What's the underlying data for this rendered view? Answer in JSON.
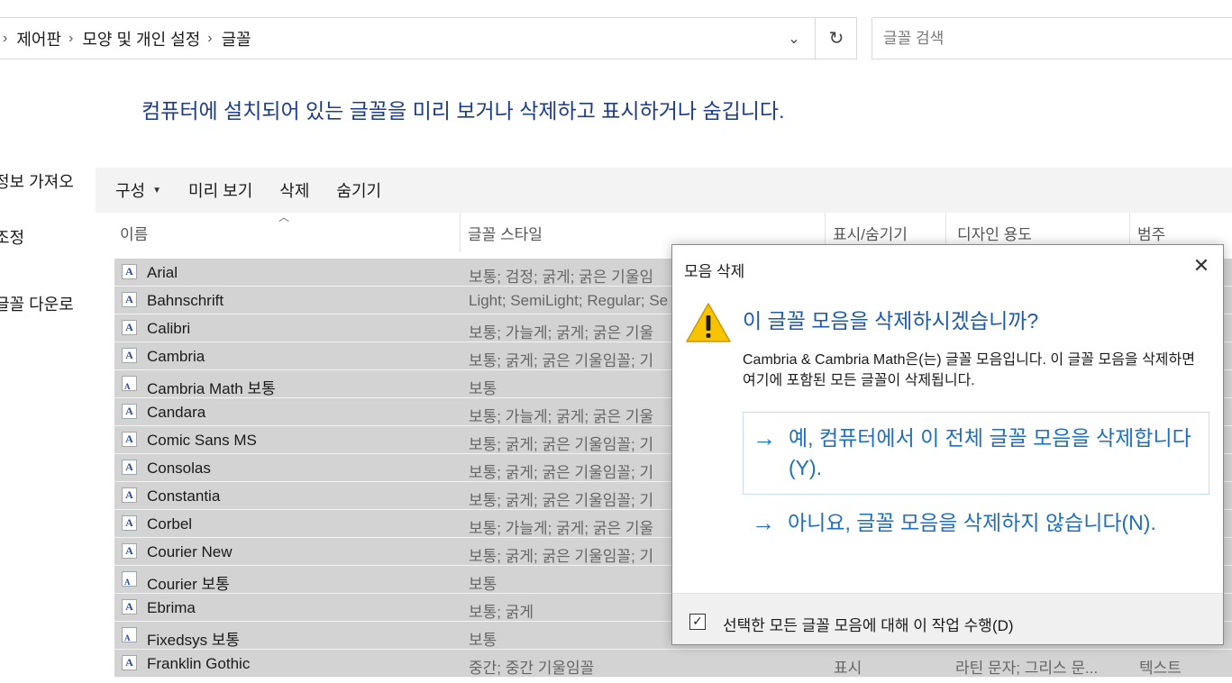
{
  "address_bar": {
    "crumbs": [
      "제어판",
      "모양 및 개인 설정",
      "글꼴"
    ],
    "search_placeholder": "글꼴 검색"
  },
  "headline": "컴퓨터에 설치되어 있는 글꼴을 미리 보거나 삭제하고 표시하거나 숨깁니다.",
  "left_nav": [
    "정보 가져오",
    "조정",
    "글꼴 다운로"
  ],
  "toolbar": {
    "organize": "구성",
    "preview": "미리 보기",
    "delete": "삭제",
    "hide": "숨기기"
  },
  "columns": {
    "name": "이름",
    "style": "글꼴 스타일",
    "show_hide": "표시/숨기기",
    "design": "디자인 용도",
    "category": "범주"
  },
  "fonts": [
    {
      "name": "Arial",
      "style": "보통; 검정; 굵게; 굵은 기울임",
      "icon": "family"
    },
    {
      "name": "Bahnschrift",
      "style": "Light; SemiLight; Regular; Se",
      "icon": "family"
    },
    {
      "name": "Calibri",
      "style": "보통; 가늘게; 굵게; 굵은 기울",
      "icon": "family"
    },
    {
      "name": "Cambria",
      "style": "보통; 굵게; 굵은 기울임꼴; 기",
      "icon": "family"
    },
    {
      "name": "Cambria Math 보통",
      "style": "보통",
      "icon": "single"
    },
    {
      "name": "Candara",
      "style": "보통; 가늘게; 굵게; 굵은 기울",
      "icon": "family"
    },
    {
      "name": "Comic Sans MS",
      "style": "보통; 굵게; 굵은 기울임꼴; 기",
      "icon": "family"
    },
    {
      "name": "Consolas",
      "style": "보통; 굵게; 굵은 기울임꼴; 기",
      "icon": "family"
    },
    {
      "name": "Constantia",
      "style": "보통; 굵게; 굵은 기울임꼴; 기",
      "icon": "family"
    },
    {
      "name": "Corbel",
      "style": "보통; 가늘게; 굵게; 굵은 기울",
      "icon": "family"
    },
    {
      "name": "Courier New",
      "style": "보통; 굵게; 굵은 기울임꼴; 기",
      "icon": "family"
    },
    {
      "name": "Courier 보통",
      "style": "보통",
      "icon": "single"
    },
    {
      "name": "Ebrima",
      "style": "보통; 굵게",
      "icon": "family"
    },
    {
      "name": "Fixedsys 보통",
      "style": "보통",
      "icon": "single"
    },
    {
      "name": "Franklin Gothic",
      "style": "중간; 중간 기울임꼴",
      "show": "표시",
      "design": "라틴 문자; 그리스 문...",
      "category": "텍스트",
      "icon": "family"
    }
  ],
  "dialog": {
    "title": "모음 삭제",
    "close": "✕",
    "question": "이 글꼴 모음을 삭제하시겠습니까?",
    "message": "Cambria & Cambria Math은(는) 글꼴 모음입니다. 이 글꼴 모음을 삭제하면 여기에 포함된 모든 글꼴이 삭제됩니다.",
    "yes_option": "예, 컴퓨터에서 이 전체 글꼴 모음을 삭제합니다(Y).",
    "no_option": "아니요, 글꼴 모음을 삭제하지 않습니다(N).",
    "apply_all": "선택한 모든 글꼴 모음에 대해 이 작업 수행(D)",
    "apply_all_checked": true
  },
  "colors": {
    "headline": "#1e3c87",
    "link": "#1e6fbf",
    "row_selected": "#d3d3d3",
    "warning": "#f8c400"
  }
}
